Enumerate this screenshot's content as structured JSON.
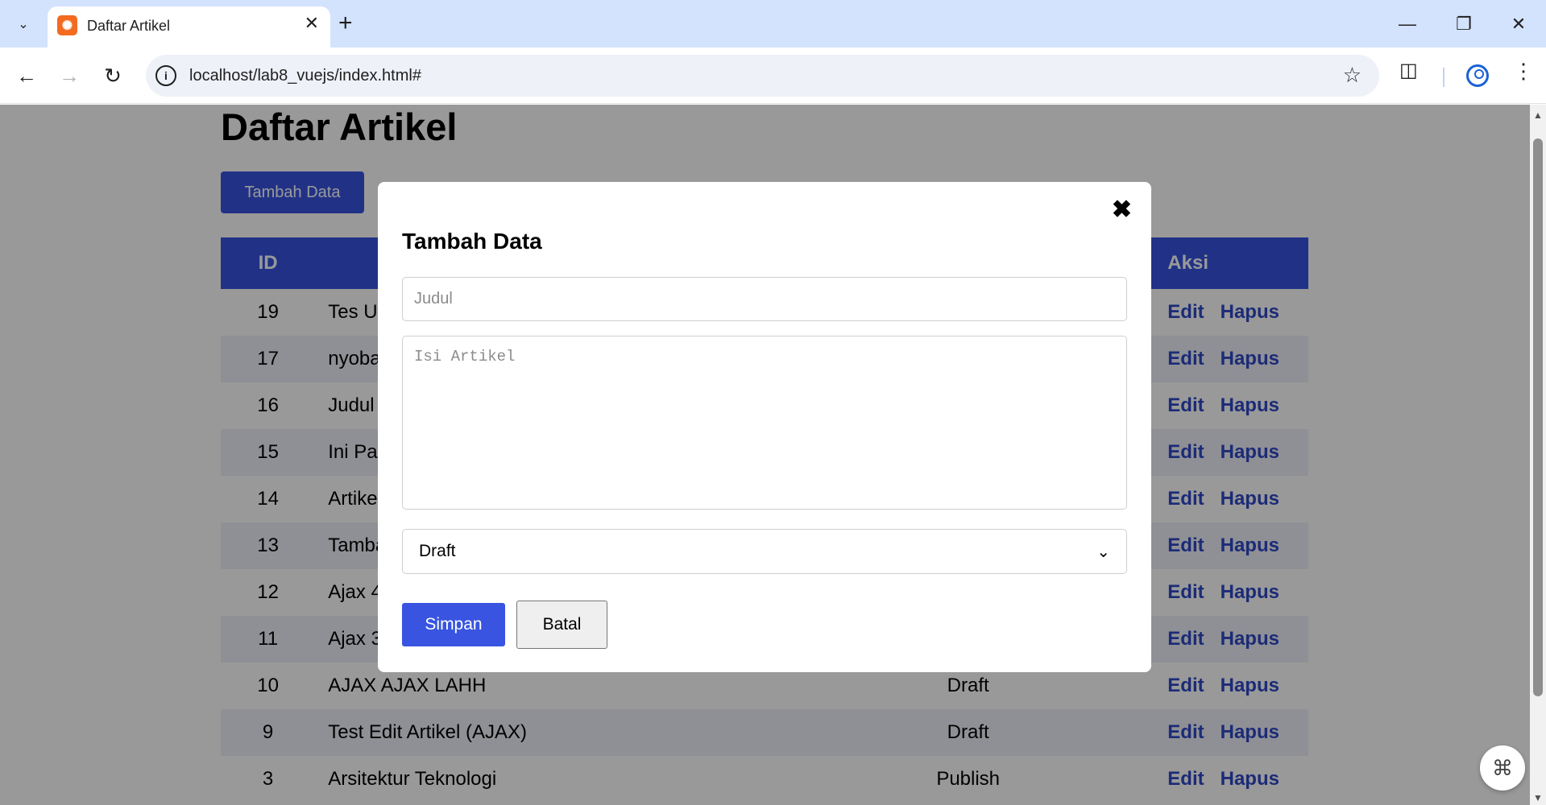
{
  "browser": {
    "tab_title": "Daftar Artikel",
    "url": "localhost/lab8_vuejs/index.html#",
    "icons": [
      "tab-search-icon",
      "close-icon",
      "plus-icon",
      "minimize-icon",
      "restore-icon",
      "close-window-icon",
      "back-arrow-icon",
      "forward-arrow-icon",
      "reload-icon",
      "site-info-icon",
      "star-icon",
      "extensions-icon",
      "profile-icon",
      "menu-dots-icon"
    ]
  },
  "page": {
    "title": "Daftar Artikel",
    "add_button": "Tambah Data"
  },
  "table": {
    "headers": {
      "id": "ID",
      "aksi": "Aksi"
    },
    "edit_label": "Edit",
    "delete_label": "Hapus",
    "rows": [
      {
        "id": "19",
        "title": "Tes U",
        "status": ""
      },
      {
        "id": "17",
        "title": "nyoba",
        "status": ""
      },
      {
        "id": "16",
        "title": "Judul",
        "status": ""
      },
      {
        "id": "15",
        "title": "Ini Pa",
        "status": ""
      },
      {
        "id": "14",
        "title": "Artike",
        "status": ""
      },
      {
        "id": "13",
        "title": "Tamba",
        "status": ""
      },
      {
        "id": "12",
        "title": "Ajax 4",
        "status": ""
      },
      {
        "id": "11",
        "title": "Ajax 3",
        "status": ""
      },
      {
        "id": "10",
        "title": "AJAX AJAX LAHH",
        "status": "Draft"
      },
      {
        "id": "9",
        "title": "Test Edit Artikel (AJAX)",
        "status": "Draft"
      },
      {
        "id": "3",
        "title": "Arsitektur Teknologi",
        "status": "Publish"
      }
    ]
  },
  "modal": {
    "title": "Tambah Data",
    "judul_placeholder": "Judul",
    "isi_placeholder": "Isi Artikel",
    "status_value": "Draft",
    "save_label": "Simpan",
    "cancel_label": "Batal"
  },
  "colors": {
    "primary": "#3854e0",
    "link": "#2f48c7",
    "tabbar": "#d3e3fd"
  }
}
